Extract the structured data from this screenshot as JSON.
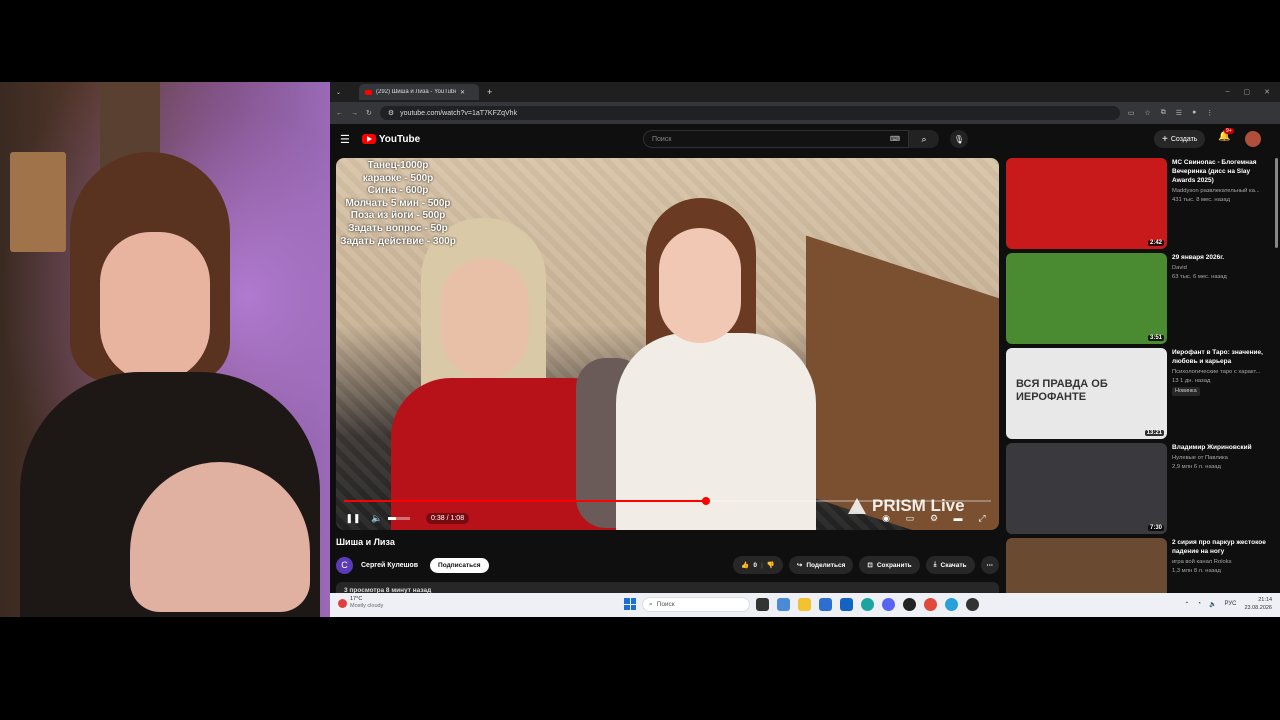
{
  "browser": {
    "tab_title": "(292) Шиша и Лиза - YouTube",
    "url": "youtube.com/watch?v=1aT7KFZqVhk"
  },
  "youtube": {
    "logo": "YouTube",
    "search_placeholder": "Поиск",
    "create_label": "Создать",
    "notifications_badge": "9+"
  },
  "video": {
    "pricelist": [
      "Танец-1000р",
      "караоке - 500р",
      "Сигна - 600р",
      "Молчать 5 мин - 500р",
      "Поза из йоги - 500р",
      "Задать вопрос - 50р",
      "Задать действие - 300р"
    ],
    "watermark": "PRISM Live",
    "current_time": "0:38",
    "duration": "1:08",
    "time_display": "0:38 / 1:08",
    "progress_fraction": 0.56,
    "volume_fraction": 0.35,
    "title": "Шиша и Лиза",
    "channel_initial": "С",
    "channel_name": "Сергей Кулешов",
    "subscribe_label": "Подписаться",
    "likes": "0",
    "share_label": "Поделиться",
    "save_label": "Сохранить",
    "download_label": "Скачать",
    "description_preview": "3 просмотра  8 минут назад"
  },
  "related": [
    {
      "title": "МС Свинопас - Блогемная Вечеринка (дисс на Slay Awards 2025)",
      "channel": "Maddyson развлекательный ка...",
      "meta": "431 тыс.  8 мес. назад",
      "duration": "2:42",
      "color": "#c81a1a"
    },
    {
      "title": "29 января 2026г.",
      "channel": "David",
      "meta": "63 тыс.  6 мес. назад",
      "duration": "3:51",
      "color": "#4a8a30"
    },
    {
      "title": "Иерофант в Таро: значение, любовь и карьера",
      "channel": "Психологические таро с характ...",
      "meta": "13  1 дн. назад",
      "duration": "13:21",
      "badge": "Новинка",
      "thumb_text": "ВСЯ ПРАВДА ОБ ИЕРОФАНТЕ",
      "color": "#e8e8e8"
    },
    {
      "title": "Владимир Жириновский",
      "channel": "Нулевые от Павлика",
      "meta": "2,9 млн  6 л. назад",
      "duration": "7:30",
      "color": "#3a3a3e"
    },
    {
      "title": "2 сирия про паркур жестокое падение на ногу",
      "channel": "игра вой канал Roloks",
      "meta": "1,3 млн  8 л. назад",
      "duration": "",
      "color": "#6a4a30"
    }
  ],
  "taskbar": {
    "weather_temp": "17°C",
    "weather_desc": "Mostly cloudy",
    "search_placeholder": "Поиск",
    "lang": "РУС",
    "time": "21:14",
    "date": "23.08.2026"
  }
}
